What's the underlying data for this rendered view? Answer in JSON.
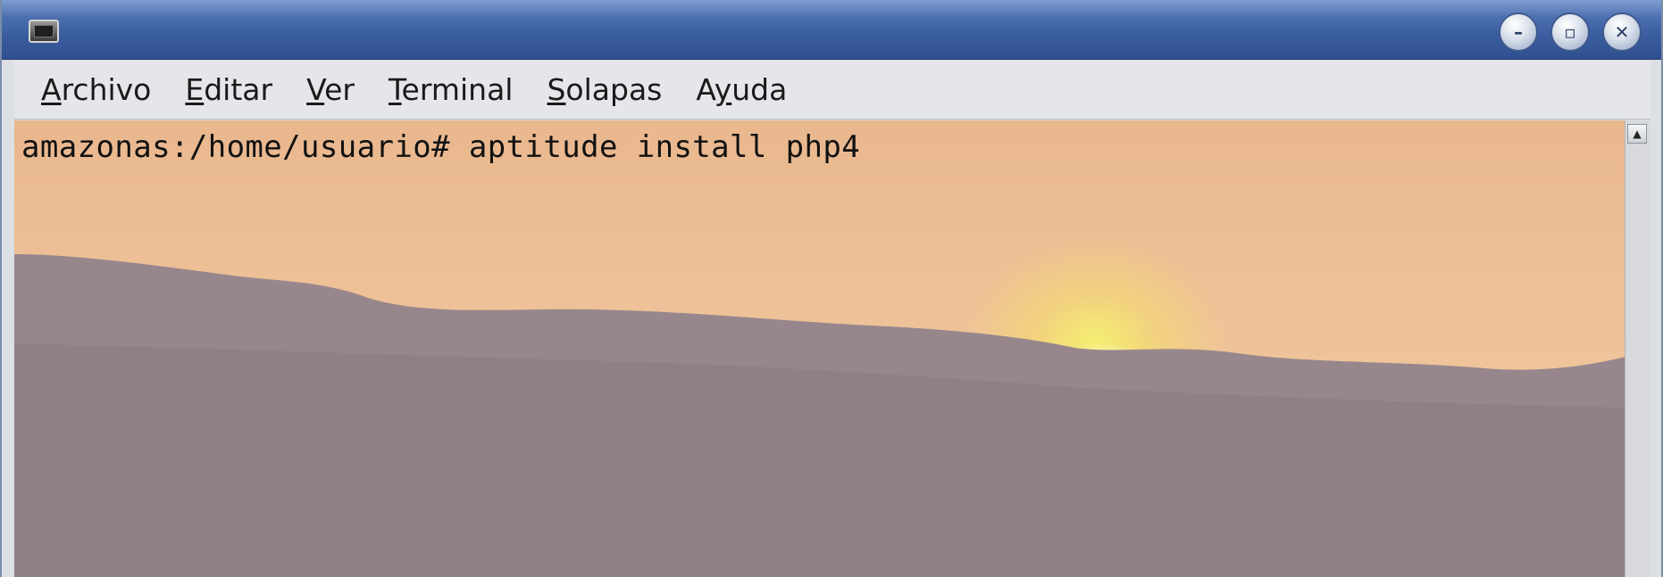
{
  "window": {
    "icons": {
      "app": "terminal-icon",
      "minimize": "minimize-icon",
      "maximize": "maximize-icon",
      "close": "close-icon"
    }
  },
  "menu": {
    "items": [
      {
        "pre": "",
        "key": "A",
        "post": "rchivo"
      },
      {
        "pre": "",
        "key": "E",
        "post": "ditar"
      },
      {
        "pre": "",
        "key": "V",
        "post": "er"
      },
      {
        "pre": "",
        "key": "T",
        "post": "erminal"
      },
      {
        "pre": "",
        "key": "S",
        "post": "olapas"
      },
      {
        "pre": "A",
        "key": "y",
        "post": "uda"
      }
    ]
  },
  "terminal": {
    "prompt_line": "amazonas:/home/usuario# aptitude install php4",
    "background": {
      "sky": "#eebf97",
      "sun": "#fff4b0",
      "hills": "#8c7d86"
    }
  },
  "scrollbar": {
    "up_arrow": "▲"
  }
}
